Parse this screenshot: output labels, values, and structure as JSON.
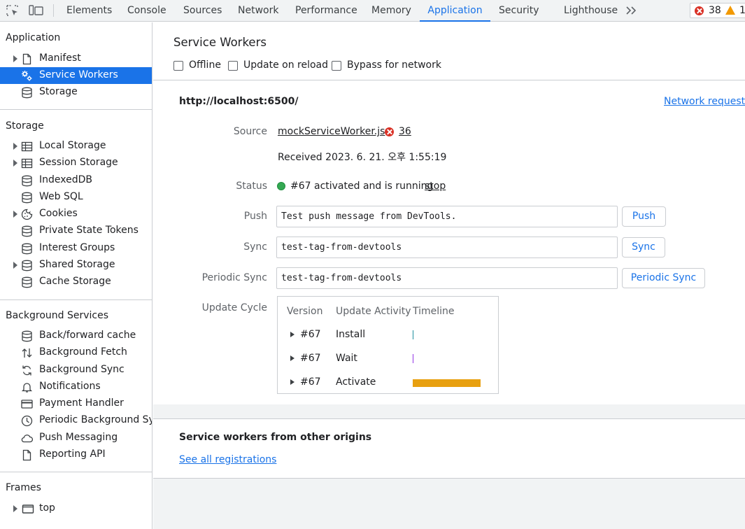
{
  "toolbar": {
    "tabs": [
      "Elements",
      "Console",
      "Sources",
      "Network",
      "Performance",
      "Memory",
      "Application",
      "Security",
      "Lighthouse"
    ],
    "active_tab": "Application",
    "error_count": "38",
    "warning_count": "1"
  },
  "sidebar": {
    "sections": [
      {
        "title": "Application",
        "items": [
          "Manifest",
          "Service Workers",
          "Storage"
        ]
      },
      {
        "title": "Storage",
        "items": [
          "Local Storage",
          "Session Storage",
          "IndexedDB",
          "Web SQL",
          "Cookies",
          "Private State Tokens",
          "Interest Groups",
          "Shared Storage",
          "Cache Storage"
        ]
      },
      {
        "title": "Background Services",
        "items": [
          "Back/forward cache",
          "Background Fetch",
          "Background Sync",
          "Notifications",
          "Payment Handler",
          "Periodic Background Sync",
          "Push Messaging",
          "Reporting API"
        ]
      },
      {
        "title": "Frames",
        "items": [
          "top"
        ]
      }
    ],
    "selected": "Service Workers"
  },
  "main": {
    "title": "Service Workers",
    "checkboxes": [
      "Offline",
      "Update on reload",
      "Bypass for network"
    ],
    "origin": "http://localhost:6500/",
    "network_requests_link": "Network requests",
    "source_label": "Source",
    "source_file": "mockServiceWorker.js",
    "source_error_count": "36",
    "received": "Received 2023. 6. 21. 오후 1:55:19",
    "status_label": "Status",
    "status_text": "#67 activated and is running",
    "stop_link": "stop",
    "push_label": "Push",
    "push_value": "Test push message from DevTools.",
    "push_button": "Push",
    "sync_label": "Sync",
    "sync_value": "test-tag-from-devtools",
    "sync_button": "Sync",
    "periodic_label": "Periodic Sync",
    "periodic_value": "test-tag-from-devtools",
    "periodic_button": "Periodic Sync",
    "update_cycle_label": "Update Cycle",
    "update_cycle": {
      "headers": [
        "Version",
        "Update Activity",
        "Timeline"
      ],
      "rows": [
        {
          "version": "#67",
          "activity": "Install"
        },
        {
          "version": "#67",
          "activity": "Wait"
        },
        {
          "version": "#67",
          "activity": "Activate"
        }
      ]
    },
    "other_origins_title": "Service workers from other origins",
    "see_all_link": "See all registrations"
  },
  "colors": {
    "accent": "#1a73e8",
    "error": "#d93025",
    "warning": "#f29900",
    "running": "#34a853",
    "activate_bar": "#e8a010"
  }
}
